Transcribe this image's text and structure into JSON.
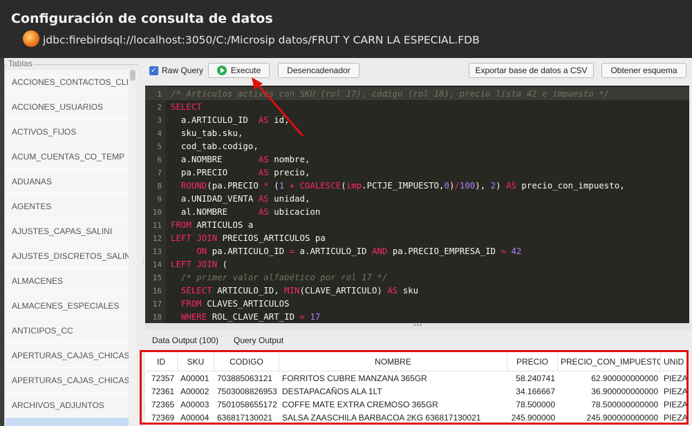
{
  "window": {
    "title": "Configuración de consulta de datos",
    "connection": "jdbc:firebirdsql://localhost:3050/C:/Microsip datos/FRUT Y CARN LA ESPECIAL.FDB"
  },
  "sidebar": {
    "legend": "Tablas",
    "items": [
      "ACCIONES_CONTACTOS_CLIENTES",
      "ACCIONES_USUARIOS",
      "ACTIVOS_FIJOS",
      "ACUM_CUENTAS_CO_TEMP",
      "ADUANAS",
      "AGENTES",
      "AJUSTES_CAPAS_SALINI",
      "AJUSTES_DISCRETOS_SALINI",
      "ALMACENES",
      "ALMACENES_ESPECIALES",
      "ANTICIPOS_CC",
      "APERTURAS_CAJAS_CHICAS",
      "APERTURAS_CAJAS_CHICAS_DET",
      "ARCHIVOS_ADJUNTOS",
      ""
    ]
  },
  "toolbar": {
    "raw_query_label": "Raw Query",
    "raw_query_checked": true,
    "execute_label": "Execute",
    "trigger_label": "Desencadenador",
    "export_label": "Exportar base de datos a CSV",
    "schema_label": "Obtener esquema"
  },
  "editor": {
    "lines": [
      "/* Artículos activos con SKU (rol 17), código (rol 18), precio lista 42 e impuesto */",
      "SELECT",
      "  a.ARTICULO_ID  AS id,",
      "  sku_tab.sku,",
      "  cod_tab.codigo,",
      "  a.NOMBRE       AS nombre,",
      "  pa.PRECIO      AS precio,",
      "  ROUND(pa.PRECIO * (1 + COALESCE(imp.PCTJE_IMPUESTO,0)/100), 2) AS precio_con_impuesto,",
      "  a.UNIDAD_VENTA AS unidad,",
      "  al.NOMBRE      AS ubicacion",
      "FROM ARTICULOS a",
      "LEFT JOIN PRECIOS_ARTICULOS pa",
      "     ON pa.ARTICULO_ID = a.ARTICULO_ID AND pa.PRECIO_EMPRESA_ID = 42",
      "LEFT JOIN (",
      "  /* primer valor alfabético por rol 17 */",
      "  SELECT ARTICULO_ID, MIN(CLAVE_ARTICULO) AS sku",
      "  FROM CLAVES_ARTICULOS",
      "  WHERE ROL_CLAVE_ART_ID = 17"
    ]
  },
  "results": {
    "tab_data": "Data Output (100)",
    "tab_query": "Query Output",
    "columns": [
      "ID",
      "SKU",
      "CODIGO",
      "NOMBRE",
      "PRECIO",
      "PRECIO_CON_IMPUESTO",
      "UNID"
    ],
    "rows": [
      [
        "72357",
        "A00001",
        "703885063121",
        "FORRITOS CUBRE MANZANA 365GR",
        "58.240741",
        "62.900000000000",
        "PIEZA"
      ],
      [
        "72361",
        "A00002",
        "7503008826953",
        "DESTAPACAÑOS ALA 1LT",
        "34.166667",
        "36.900000000000",
        "PIEZA"
      ],
      [
        "72365",
        "A00003",
        "7501058655172",
        "COFFE MATE EXTRA CREMOSO 365GR",
        "78.500000",
        "78.500000000000",
        "PIEZA"
      ],
      [
        "72369",
        "A00004",
        "636817130021",
        "SALSA ZAASCHILA BARBACOA 2KG 636817130021",
        "245.900000",
        "245.900000000000",
        "PIEZA"
      ]
    ]
  },
  "colors": {
    "annotation_red": "#e01010",
    "editor_bg": "#272822",
    "keyword": "#f92672",
    "comment": "#75715e",
    "number": "#ae81ff"
  }
}
